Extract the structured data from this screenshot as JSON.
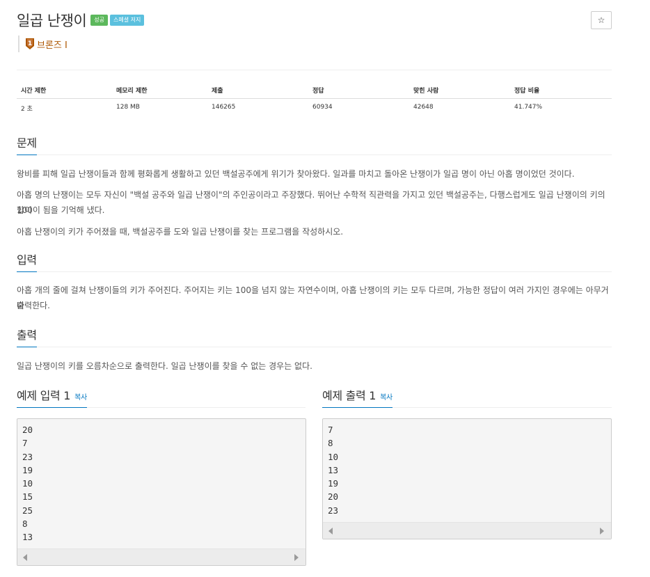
{
  "problem": {
    "title": "일곱 난쟁이",
    "badges": [
      "성공",
      "스페셜 저지"
    ],
    "tier": "브론즈 I",
    "star_icon": "☆",
    "tier_icon": "bronze-tier-badge-icon"
  },
  "stats": {
    "headers": [
      "시간 제한",
      "메모리 제한",
      "제출",
      "정답",
      "맞힌 사람",
      "정답 비율"
    ],
    "values": [
      "2 초",
      "128 MB",
      "146265",
      "60934",
      "42648",
      "41.747%"
    ]
  },
  "sections": {
    "description": {
      "title": "문제",
      "paragraphs": [
        "왕비를 피해 일곱 난쟁이들과 함께 평화롭게 생활하고 있던 백설공주에게 위기가 찾아왔다. 일과를 마치고 돌아온 난쟁이가 일곱 명이 아닌 아홉 명이었던 것이다.",
        "아홉 명의 난쟁이는 모두 자신이 \"백설 공주와 일곱 난쟁이\"의 주인공이라고 주장했다. 뛰어난 수학적 직관력을 가지고 있던 백설공주는, 다행스럽게도 일곱 난쟁이의 키의 합이",
        "100이 됨을 기억해 냈다.",
        "아홉 난쟁이의 키가 주어졌을 때, 백설공주를 도와 일곱 난쟁이를 찾는 프로그램을 작성하시오."
      ]
    },
    "input": {
      "title": "입력",
      "paragraphs": [
        "아홉 개의 줄에 걸쳐 난쟁이들의 키가 주어진다. 주어지는 키는 100을 넘지 않는 자연수이며, 아홉 난쟁이의 키는 모두 다르며, 가능한 정답이 여러 가지인 경우에는 아무거나",
        "출력한다."
      ]
    },
    "output": {
      "title": "출력",
      "paragraphs": [
        "일곱 난쟁이의 키를 오름차순으로 출력한다. 일곱 난쟁이를 찾을 수 없는 경우는 없다."
      ]
    }
  },
  "samples": {
    "input_title": "예제 입력 1",
    "output_title": "예제 출력 1",
    "copy_label": "복사",
    "input_text": "20\n7\n23\n19\n10\n15\n25\n8\n13",
    "output_text": "7\n8\n10\n13\n19\n20\n23"
  },
  "colors": {
    "accent": "#0076c0",
    "success_badge": "#5cb85c",
    "info_badge": "#5bc0de",
    "bronze": "#ad5600"
  }
}
